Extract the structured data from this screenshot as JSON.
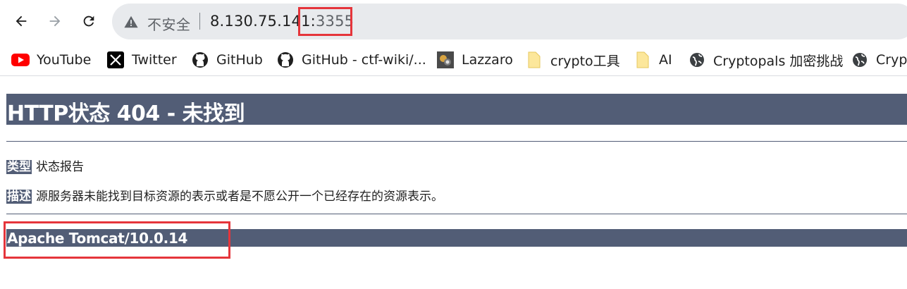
{
  "browser": {
    "address_bar": {
      "security_label": "不安全",
      "host": "8.130.75.141:",
      "port": "3355"
    },
    "bookmarks": [
      {
        "label": "YouTube",
        "icon": "youtube-icon"
      },
      {
        "label": "Twitter",
        "icon": "x-twitter-icon"
      },
      {
        "label": "GitHub",
        "icon": "github-icon"
      },
      {
        "label": "GitHub - ctf-wiki/...",
        "icon": "github-icon"
      },
      {
        "label": "Lazzaro",
        "icon": "site-favicon-icon"
      },
      {
        "label": "crypto工具",
        "icon": "folder-icon"
      },
      {
        "label": "AI",
        "icon": "folder-icon"
      },
      {
        "label": "Cryptopals 加密挑战",
        "icon": "globe-icon"
      },
      {
        "label": "Crypt",
        "icon": "globe-icon"
      }
    ]
  },
  "page": {
    "title": "HTTP状态 404 - 未找到",
    "type_label": "类型",
    "type_value": "状态报告",
    "desc_label": "描述",
    "desc_value": "源服务器未能找到目标资源的表示或者是不愿公开一个已经存在的资源表示。",
    "server_version": "Apache Tomcat/10.0.14"
  },
  "colors": {
    "tomcat_bar": "#525d76",
    "annotation_red": "#e5353b",
    "omnibox_bg": "#e8eaed"
  }
}
